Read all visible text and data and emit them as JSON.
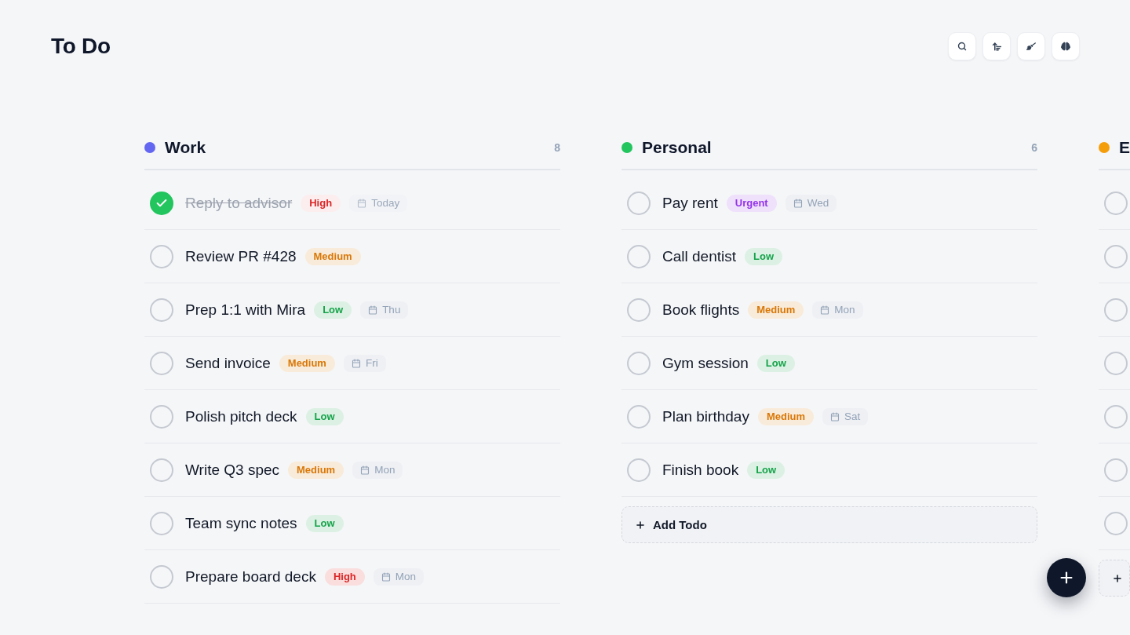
{
  "page": {
    "title": "To Do"
  },
  "columns": [
    {
      "title": "Work",
      "color": "#6366f1",
      "count": "8",
      "todos": [
        {
          "title": "Reply to advisor",
          "done": true,
          "priority": {
            "label": "High",
            "color": "#dc2626"
          },
          "due": "Today"
        },
        {
          "title": "Review PR #428",
          "done": false,
          "priority": {
            "label": "Medium",
            "color": "#d97706"
          }
        },
        {
          "title": "Prep 1:1 with Mira",
          "done": false,
          "priority": {
            "label": "Low",
            "color": "#16a34a"
          },
          "due": "Thu"
        },
        {
          "title": "Send invoice",
          "done": false,
          "priority": {
            "label": "Medium",
            "color": "#d97706"
          },
          "due": "Fri"
        },
        {
          "title": "Polish pitch deck",
          "done": false,
          "priority": {
            "label": "Low",
            "color": "#16a34a"
          }
        },
        {
          "title": "Write Q3 spec",
          "done": false,
          "priority": {
            "label": "Medium",
            "color": "#d97706"
          },
          "due": "Mon"
        },
        {
          "title": "Team sync notes",
          "done": false,
          "priority": {
            "label": "Low",
            "color": "#16a34a"
          }
        },
        {
          "title": "Prepare board deck",
          "done": false,
          "priority": {
            "label": "High",
            "color": "#dc2626"
          },
          "due": "Mon"
        }
      ]
    },
    {
      "title": "Personal",
      "color": "#22c55e",
      "count": "6",
      "todos": [
        {
          "title": "Pay rent",
          "done": false,
          "priority": {
            "label": "Urgent",
            "color": "#9333ea"
          },
          "due": "Wed"
        },
        {
          "title": "Call dentist",
          "done": false,
          "priority": {
            "label": "Low",
            "color": "#16a34a"
          }
        },
        {
          "title": "Book flights",
          "done": false,
          "priority": {
            "label": "Medium",
            "color": "#d97706"
          },
          "due": "Mon"
        },
        {
          "title": "Gym session",
          "done": false,
          "priority": {
            "label": "Low",
            "color": "#16a34a"
          }
        },
        {
          "title": "Plan birthday",
          "done": false,
          "priority": {
            "label": "Medium",
            "color": "#d97706"
          },
          "due": "Sat"
        },
        {
          "title": "Finish book",
          "done": false,
          "priority": {
            "label": "Low",
            "color": "#16a34a"
          }
        }
      ],
      "add_button": {
        "shown": true,
        "label": "Add Todo"
      }
    },
    {
      "title": "E",
      "color": "#f59e0b",
      "todos": [
        {
          "done": false
        },
        {
          "done": false
        },
        {
          "done": false
        },
        {
          "done": false
        },
        {
          "done": false
        },
        {
          "done": false
        },
        {
          "done": false
        }
      ],
      "add_button": {
        "shown": true
      }
    }
  ]
}
